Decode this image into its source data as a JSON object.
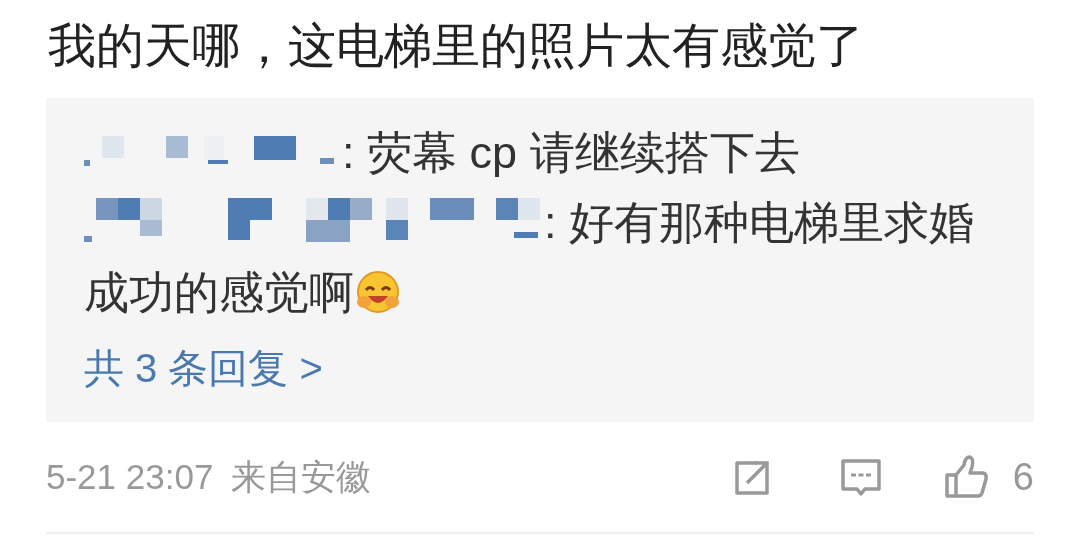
{
  "comment": {
    "text": "我的天哪，这电梯里的照片太有感觉了"
  },
  "replies": [
    {
      "lines": [
        ": 荧幕 cp 请继续搭下去"
      ],
      "emoji": false
    },
    {
      "lines": [
        ": 好有那种电梯里求婚",
        "成功的感觉啊"
      ],
      "emoji": true
    }
  ],
  "more_replies": "共 3 条回复 >",
  "footer": {
    "time": "5-21 23:07",
    "source": "来自安徽",
    "likes": "6"
  }
}
